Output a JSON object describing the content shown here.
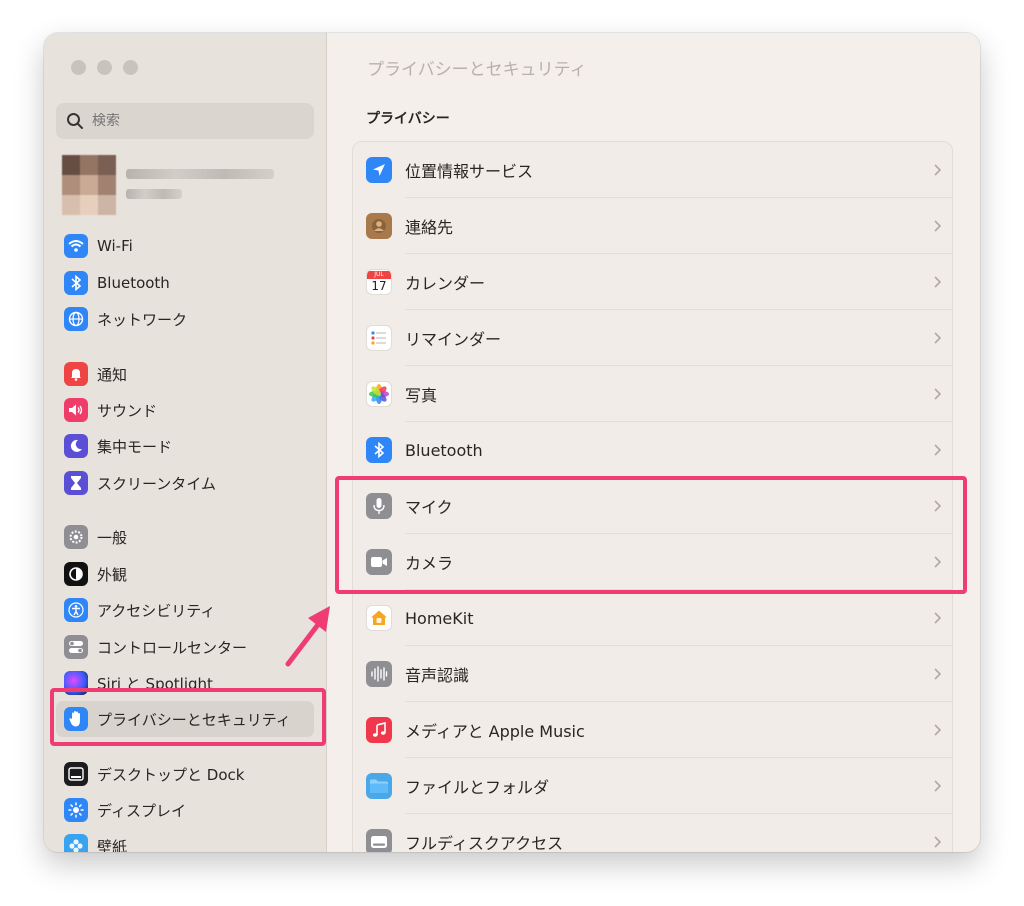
{
  "window": {
    "title": "プライバシーとセキュリティ"
  },
  "sidebar": {
    "search": {
      "placeholder": "検索"
    },
    "items": [
      {
        "label": "Wi-Fi",
        "icon": "wifi-icon",
        "color": "#2f86f6"
      },
      {
        "label": "Bluetooth",
        "icon": "bluetooth-icon",
        "color": "#2f86f6"
      },
      {
        "label": "ネットワーク",
        "icon": "globe-icon",
        "color": "#2f86f6"
      },
      {
        "label": "通知",
        "icon": "bell-icon",
        "color": "#ef4444"
      },
      {
        "label": "サウンド",
        "icon": "speaker-icon",
        "color": "#ef3d6a"
      },
      {
        "label": "集中モード",
        "icon": "moon-icon",
        "color": "#5b4fd6"
      },
      {
        "label": "スクリーンタイム",
        "icon": "hourglass-icon",
        "color": "#5b4fd6"
      },
      {
        "label": "一般",
        "icon": "gear-icon",
        "color": "#8e8e93"
      },
      {
        "label": "外観",
        "icon": "appearance-icon",
        "color": "#111111"
      },
      {
        "label": "アクセシビリティ",
        "icon": "accessibility-icon",
        "color": "#2f86f6"
      },
      {
        "label": "コントロールセンター",
        "icon": "toggle-icon",
        "color": "#8e8e93"
      },
      {
        "label": "Siri と Spotlight",
        "icon": "siri-icon",
        "color": "#7a3cff"
      },
      {
        "label": "プライバシーとセキュリティ",
        "icon": "hand-icon",
        "color": "#2f86f6",
        "active": true
      },
      {
        "label": "デスクトップと Dock",
        "icon": "dock-icon",
        "color": "#1c1c1e"
      },
      {
        "label": "ディスプレイ",
        "icon": "sun-icon",
        "color": "#2f86f6"
      },
      {
        "label": "壁紙",
        "icon": "flower-icon",
        "color": "#3aa3f0"
      }
    ]
  },
  "main": {
    "section": "プライバシー",
    "rows": [
      {
        "label": "位置情報サービス",
        "icon": "location-arrow-icon",
        "color": "#2f86f6"
      },
      {
        "label": "連絡先",
        "icon": "contacts-icon",
        "color": "#a87a4b"
      },
      {
        "label": "カレンダー",
        "icon": "calendar-icon",
        "color": "#ffffff",
        "month": "JUL",
        "day": "17"
      },
      {
        "label": "リマインダー",
        "icon": "reminders-icon",
        "color": "#ffffff"
      },
      {
        "label": "写真",
        "icon": "photos-icon",
        "color": "#ffffff"
      },
      {
        "label": "Bluetooth",
        "icon": "bluetooth-icon",
        "color": "#2f86f6"
      },
      {
        "label": "マイク",
        "icon": "microphone-icon",
        "color": "#8e8e93"
      },
      {
        "label": "カメラ",
        "icon": "camera-icon",
        "color": "#8e8e93"
      },
      {
        "label": "HomeKit",
        "icon": "home-icon",
        "color": "#ffffff"
      },
      {
        "label": "音声認識",
        "icon": "waveform-icon",
        "color": "#8e8e93"
      },
      {
        "label": "メディアと Apple Music",
        "icon": "music-icon",
        "color": "#f0384d"
      },
      {
        "label": "ファイルとフォルダ",
        "icon": "folder-icon",
        "color": "#4aa7e8"
      },
      {
        "label": "フルディスクアクセス",
        "icon": "disk-icon",
        "color": "#8e8e93"
      }
    ]
  },
  "annotations": {
    "highlight_color": "#ef3c73"
  }
}
